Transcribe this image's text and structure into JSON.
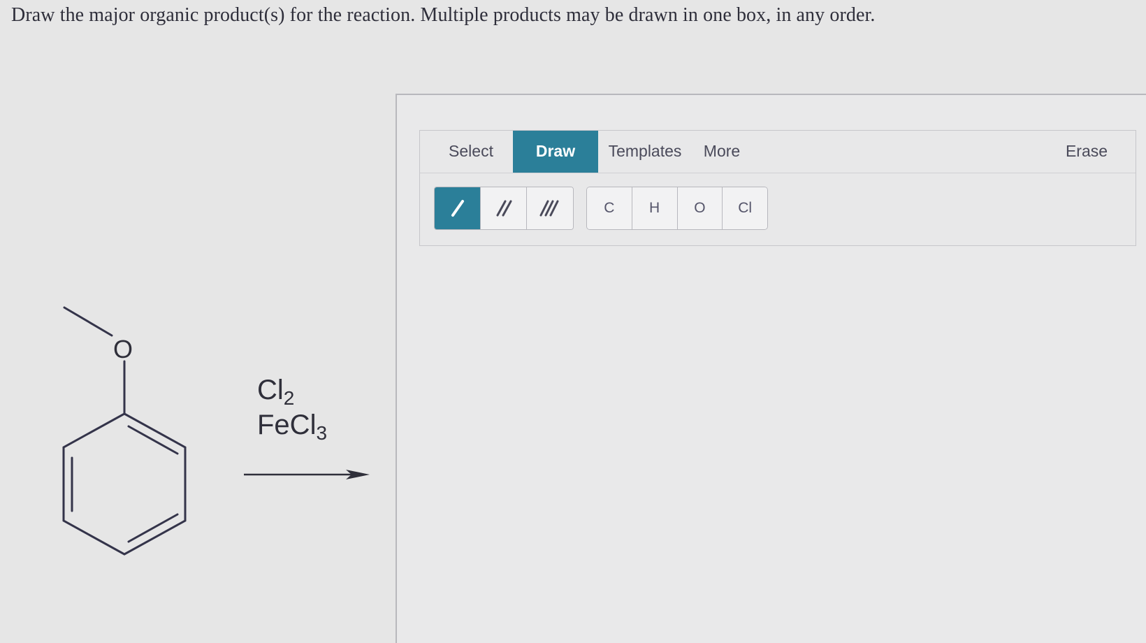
{
  "prompt": "Draw the major organic product(s) for the reaction. Multiple products may be drawn in one box, in any order.",
  "reactant": {
    "oxygen_label": "O"
  },
  "reagents": {
    "line1_symbol": "Cl",
    "line1_subscript": "2",
    "line2_symbol": "FeCl",
    "line2_subscript": "3"
  },
  "toolbar": {
    "tabs": {
      "select": "Select",
      "draw": "Draw",
      "templates": "Templates",
      "more": "More",
      "erase": "Erase"
    },
    "active_tab": "Draw",
    "bond_buttons": [
      "single-bond",
      "double-bond",
      "triple-bond"
    ],
    "active_bond": "single-bond",
    "atoms": [
      "C",
      "H",
      "O",
      "Cl"
    ]
  },
  "colors": {
    "accent": "#2b7f99",
    "background": "#e6e6e6",
    "structure_line": "#34344a"
  }
}
